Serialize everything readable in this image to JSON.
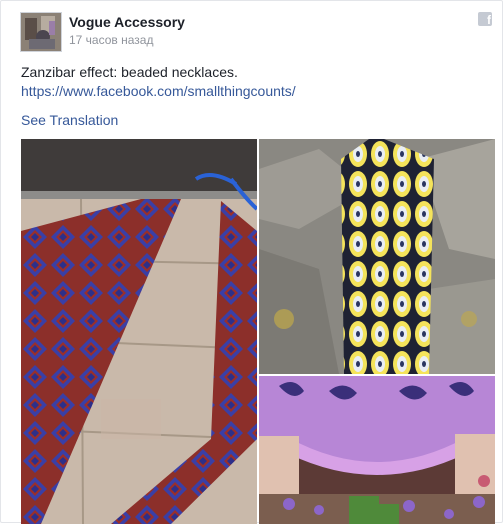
{
  "post": {
    "page_name": "Vogue Accessory",
    "timestamp": "17 часов назад",
    "text": "Zanzibar effect: beaded necklaces.",
    "link": "https://www.facebook.com/smallthingcounts/",
    "see_translation": "See Translation"
  },
  "icons": {
    "facebook": "f"
  },
  "colors": {
    "link": "#365899",
    "name": "#1d2129",
    "meta": "#90949c"
  }
}
